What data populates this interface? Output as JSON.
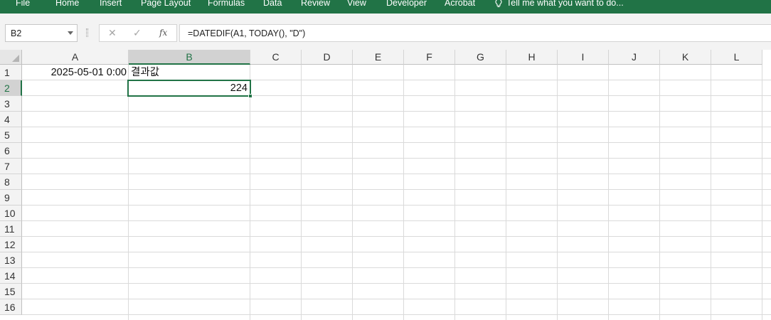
{
  "ribbon": {
    "tabs": [
      "File",
      "Home",
      "Insert",
      "Page Layout",
      "Formulas",
      "Data",
      "Review",
      "View",
      "Developer",
      "Acrobat"
    ],
    "tell_me": "Tell me what you want to do..."
  },
  "formula_bar": {
    "name_box": "B2",
    "cancel_glyph": "✕",
    "enter_glyph": "✓",
    "fx_label": "fx",
    "formula": "=DATEDIF(A1, TODAY(), \"D\")"
  },
  "sheet": {
    "columns": [
      "A",
      "B",
      "C",
      "D",
      "E",
      "F",
      "G",
      "H",
      "I",
      "J",
      "K",
      "L"
    ],
    "rows": [
      "1",
      "2",
      "3",
      "4",
      "5",
      "6",
      "7",
      "8",
      "9",
      "10",
      "11",
      "12",
      "13",
      "14",
      "15",
      "16"
    ],
    "active_cell": "B2",
    "cells": {
      "A1": "2025-05-01 0:00",
      "B1": "결과값",
      "B2": "224"
    }
  },
  "colors": {
    "accent": "#217346"
  }
}
